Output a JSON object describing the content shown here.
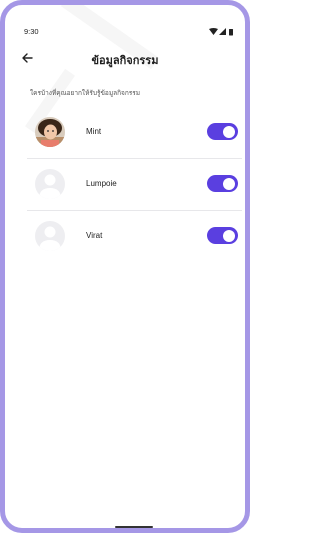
{
  "status_bar": {
    "time": "9:30",
    "icons": [
      "wifi-icon",
      "signal-icon",
      "battery-icon"
    ]
  },
  "header": {
    "title": "ข้อมูลกิจกรรม",
    "back_icon": "arrow-left-icon"
  },
  "subtitle": "ใครบ้างที่คุณอยากให้รับรู้ข้อมูลกิจกรรม",
  "contacts": [
    {
      "name": "Mint",
      "avatar": "photo",
      "enabled": true
    },
    {
      "name": "Lumpoie",
      "avatar": "placeholder",
      "enabled": true
    },
    {
      "name": "Virat",
      "avatar": "placeholder",
      "enabled": true
    }
  ],
  "colors": {
    "accent": "#5a3fe0",
    "frame": "#a597e6"
  }
}
